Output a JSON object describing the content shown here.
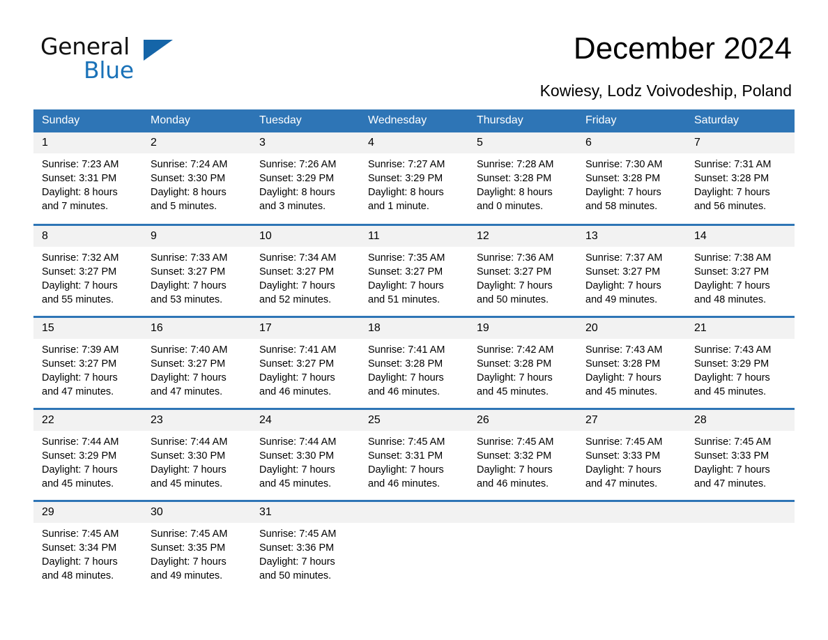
{
  "brand": {
    "name_primary": "General",
    "name_secondary": "Blue",
    "primary_color": "#111111",
    "accent_color": "#1a72b8"
  },
  "header": {
    "title": "December 2024",
    "subtitle": "Kowiesy, Lodz Voivodeship, Poland"
  },
  "calendar": {
    "header_bg": "#2e75b6",
    "daynum_bg": "#f2f2f2",
    "weekdays": [
      "Sunday",
      "Monday",
      "Tuesday",
      "Wednesday",
      "Thursday",
      "Friday",
      "Saturday"
    ],
    "weeks": [
      [
        {
          "day": "1",
          "sunrise": "Sunrise: 7:23 AM",
          "sunset": "Sunset: 3:31 PM",
          "daylight_line1": "Daylight: 8 hours",
          "daylight_line2": "and 7 minutes."
        },
        {
          "day": "2",
          "sunrise": "Sunrise: 7:24 AM",
          "sunset": "Sunset: 3:30 PM",
          "daylight_line1": "Daylight: 8 hours",
          "daylight_line2": "and 5 minutes."
        },
        {
          "day": "3",
          "sunrise": "Sunrise: 7:26 AM",
          "sunset": "Sunset: 3:29 PM",
          "daylight_line1": "Daylight: 8 hours",
          "daylight_line2": "and 3 minutes."
        },
        {
          "day": "4",
          "sunrise": "Sunrise: 7:27 AM",
          "sunset": "Sunset: 3:29 PM",
          "daylight_line1": "Daylight: 8 hours",
          "daylight_line2": "and 1 minute."
        },
        {
          "day": "5",
          "sunrise": "Sunrise: 7:28 AM",
          "sunset": "Sunset: 3:28 PM",
          "daylight_line1": "Daylight: 8 hours",
          "daylight_line2": "and 0 minutes."
        },
        {
          "day": "6",
          "sunrise": "Sunrise: 7:30 AM",
          "sunset": "Sunset: 3:28 PM",
          "daylight_line1": "Daylight: 7 hours",
          "daylight_line2": "and 58 minutes."
        },
        {
          "day": "7",
          "sunrise": "Sunrise: 7:31 AM",
          "sunset": "Sunset: 3:28 PM",
          "daylight_line1": "Daylight: 7 hours",
          "daylight_line2": "and 56 minutes."
        }
      ],
      [
        {
          "day": "8",
          "sunrise": "Sunrise: 7:32 AM",
          "sunset": "Sunset: 3:27 PM",
          "daylight_line1": "Daylight: 7 hours",
          "daylight_line2": "and 55 minutes."
        },
        {
          "day": "9",
          "sunrise": "Sunrise: 7:33 AM",
          "sunset": "Sunset: 3:27 PM",
          "daylight_line1": "Daylight: 7 hours",
          "daylight_line2": "and 53 minutes."
        },
        {
          "day": "10",
          "sunrise": "Sunrise: 7:34 AM",
          "sunset": "Sunset: 3:27 PM",
          "daylight_line1": "Daylight: 7 hours",
          "daylight_line2": "and 52 minutes."
        },
        {
          "day": "11",
          "sunrise": "Sunrise: 7:35 AM",
          "sunset": "Sunset: 3:27 PM",
          "daylight_line1": "Daylight: 7 hours",
          "daylight_line2": "and 51 minutes."
        },
        {
          "day": "12",
          "sunrise": "Sunrise: 7:36 AM",
          "sunset": "Sunset: 3:27 PM",
          "daylight_line1": "Daylight: 7 hours",
          "daylight_line2": "and 50 minutes."
        },
        {
          "day": "13",
          "sunrise": "Sunrise: 7:37 AM",
          "sunset": "Sunset: 3:27 PM",
          "daylight_line1": "Daylight: 7 hours",
          "daylight_line2": "and 49 minutes."
        },
        {
          "day": "14",
          "sunrise": "Sunrise: 7:38 AM",
          "sunset": "Sunset: 3:27 PM",
          "daylight_line1": "Daylight: 7 hours",
          "daylight_line2": "and 48 minutes."
        }
      ],
      [
        {
          "day": "15",
          "sunrise": "Sunrise: 7:39 AM",
          "sunset": "Sunset: 3:27 PM",
          "daylight_line1": "Daylight: 7 hours",
          "daylight_line2": "and 47 minutes."
        },
        {
          "day": "16",
          "sunrise": "Sunrise: 7:40 AM",
          "sunset": "Sunset: 3:27 PM",
          "daylight_line1": "Daylight: 7 hours",
          "daylight_line2": "and 47 minutes."
        },
        {
          "day": "17",
          "sunrise": "Sunrise: 7:41 AM",
          "sunset": "Sunset: 3:27 PM",
          "daylight_line1": "Daylight: 7 hours",
          "daylight_line2": "and 46 minutes."
        },
        {
          "day": "18",
          "sunrise": "Sunrise: 7:41 AM",
          "sunset": "Sunset: 3:28 PM",
          "daylight_line1": "Daylight: 7 hours",
          "daylight_line2": "and 46 minutes."
        },
        {
          "day": "19",
          "sunrise": "Sunrise: 7:42 AM",
          "sunset": "Sunset: 3:28 PM",
          "daylight_line1": "Daylight: 7 hours",
          "daylight_line2": "and 45 minutes."
        },
        {
          "day": "20",
          "sunrise": "Sunrise: 7:43 AM",
          "sunset": "Sunset: 3:28 PM",
          "daylight_line1": "Daylight: 7 hours",
          "daylight_line2": "and 45 minutes."
        },
        {
          "day": "21",
          "sunrise": "Sunrise: 7:43 AM",
          "sunset": "Sunset: 3:29 PM",
          "daylight_line1": "Daylight: 7 hours",
          "daylight_line2": "and 45 minutes."
        }
      ],
      [
        {
          "day": "22",
          "sunrise": "Sunrise: 7:44 AM",
          "sunset": "Sunset: 3:29 PM",
          "daylight_line1": "Daylight: 7 hours",
          "daylight_line2": "and 45 minutes."
        },
        {
          "day": "23",
          "sunrise": "Sunrise: 7:44 AM",
          "sunset": "Sunset: 3:30 PM",
          "daylight_line1": "Daylight: 7 hours",
          "daylight_line2": "and 45 minutes."
        },
        {
          "day": "24",
          "sunrise": "Sunrise: 7:44 AM",
          "sunset": "Sunset: 3:30 PM",
          "daylight_line1": "Daylight: 7 hours",
          "daylight_line2": "and 45 minutes."
        },
        {
          "day": "25",
          "sunrise": "Sunrise: 7:45 AM",
          "sunset": "Sunset: 3:31 PM",
          "daylight_line1": "Daylight: 7 hours",
          "daylight_line2": "and 46 minutes."
        },
        {
          "day": "26",
          "sunrise": "Sunrise: 7:45 AM",
          "sunset": "Sunset: 3:32 PM",
          "daylight_line1": "Daylight: 7 hours",
          "daylight_line2": "and 46 minutes."
        },
        {
          "day": "27",
          "sunrise": "Sunrise: 7:45 AM",
          "sunset": "Sunset: 3:33 PM",
          "daylight_line1": "Daylight: 7 hours",
          "daylight_line2": "and 47 minutes."
        },
        {
          "day": "28",
          "sunrise": "Sunrise: 7:45 AM",
          "sunset": "Sunset: 3:33 PM",
          "daylight_line1": "Daylight: 7 hours",
          "daylight_line2": "and 47 minutes."
        }
      ],
      [
        {
          "day": "29",
          "sunrise": "Sunrise: 7:45 AM",
          "sunset": "Sunset: 3:34 PM",
          "daylight_line1": "Daylight: 7 hours",
          "daylight_line2": "and 48 minutes."
        },
        {
          "day": "30",
          "sunrise": "Sunrise: 7:45 AM",
          "sunset": "Sunset: 3:35 PM",
          "daylight_line1": "Daylight: 7 hours",
          "daylight_line2": "and 49 minutes."
        },
        {
          "day": "31",
          "sunrise": "Sunrise: 7:45 AM",
          "sunset": "Sunset: 3:36 PM",
          "daylight_line1": "Daylight: 7 hours",
          "daylight_line2": "and 50 minutes."
        },
        {
          "day": "",
          "sunrise": "",
          "sunset": "",
          "daylight_line1": "",
          "daylight_line2": ""
        },
        {
          "day": "",
          "sunrise": "",
          "sunset": "",
          "daylight_line1": "",
          "daylight_line2": ""
        },
        {
          "day": "",
          "sunrise": "",
          "sunset": "",
          "daylight_line1": "",
          "daylight_line2": ""
        },
        {
          "day": "",
          "sunrise": "",
          "sunset": "",
          "daylight_line1": "",
          "daylight_line2": ""
        }
      ]
    ]
  }
}
